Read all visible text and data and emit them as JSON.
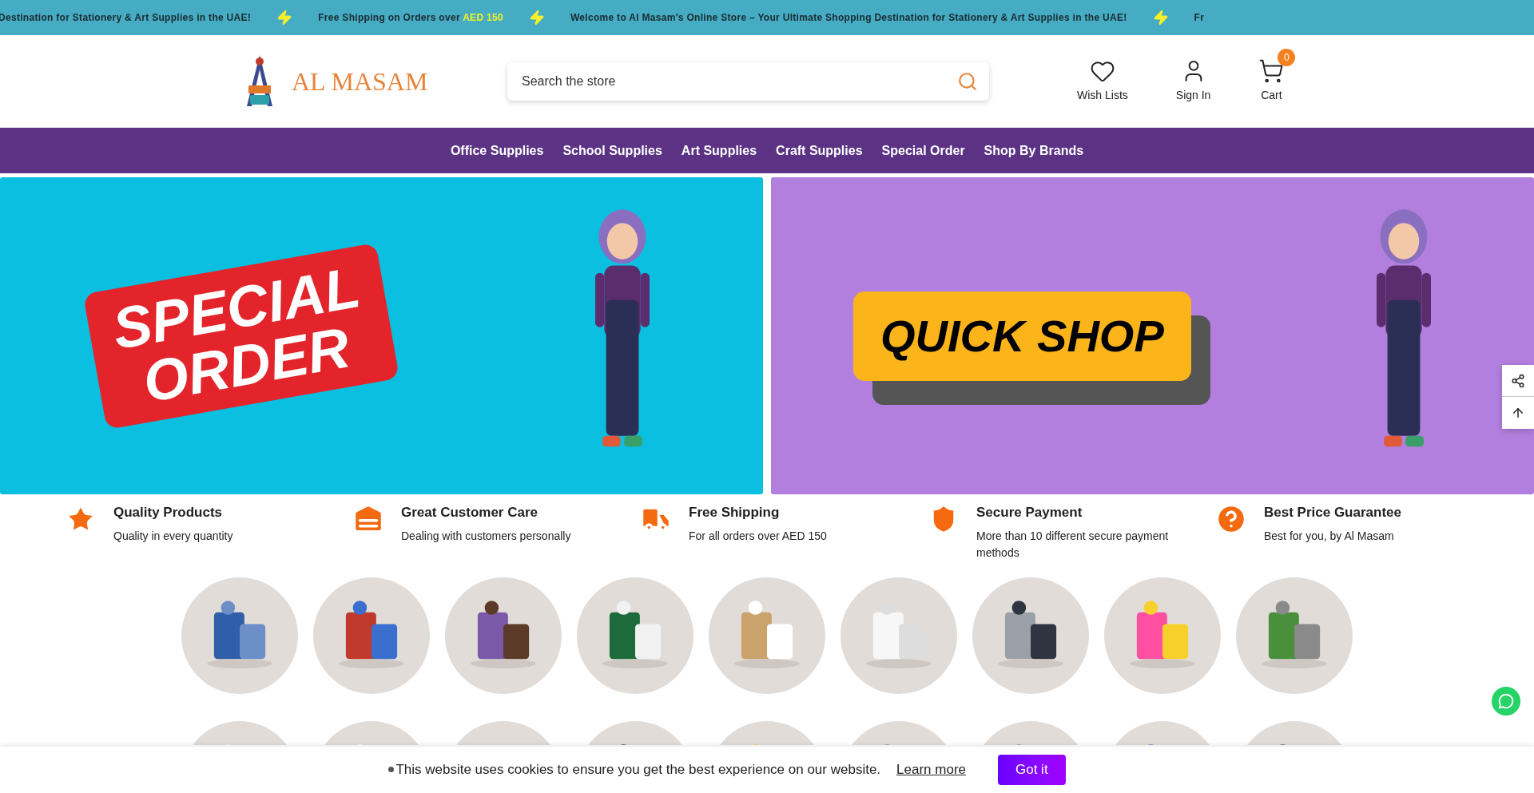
{
  "announcement_bar": {
    "items": [
      {
        "text": "Destination for Stationery & Art Supplies in the UAE!"
      },
      {
        "text": "Free Shipping on Orders over ",
        "highlight": "AED 150"
      },
      {
        "text": "Welcome to Al Masam's Online Store – Your Ultimate Shopping Destination for Stationery & Art Supplies in the UAE!"
      },
      {
        "text": "Fr"
      }
    ]
  },
  "header": {
    "logo": "AL MASAM",
    "search": {
      "placeholder": "Search the store"
    },
    "actions": [
      {
        "kind": "wishlist",
        "label": "Wish Lists"
      },
      {
        "kind": "account",
        "label": "Sign In"
      },
      {
        "kind": "cart",
        "label": "Cart",
        "badge": "0"
      }
    ]
  },
  "nav": [
    "Office Supplies",
    "School Supplies",
    "Art Supplies",
    "Craft Supplies",
    "Special Order",
    "Shop By Brands"
  ],
  "banners": [
    {
      "kind": "tag",
      "line1": "SPECIAL",
      "line2": "ORDER",
      "color": "#0bbfe0"
    },
    {
      "kind": "pill",
      "line1": "QUICK SHOP",
      "color": "#b27fde"
    }
  ],
  "features": [
    {
      "title": "Quality Products",
      "text": "Quality in every quantity"
    },
    {
      "title": "Great Customer Care",
      "text": "Dealing with customers personally"
    },
    {
      "title": "Free Shipping",
      "text": "For all orders over AED 150"
    },
    {
      "title": "Secure Payment",
      "text": "More than 10 different secure payment methods"
    },
    {
      "title": "Best Price Guarantee",
      "text": "Best for you, by Al Masam"
    }
  ],
  "cookie_bar": {
    "text": "This website uses cookies to ensure you get the best experience on our website.",
    "link": "Learn more",
    "button": "Got it"
  }
}
